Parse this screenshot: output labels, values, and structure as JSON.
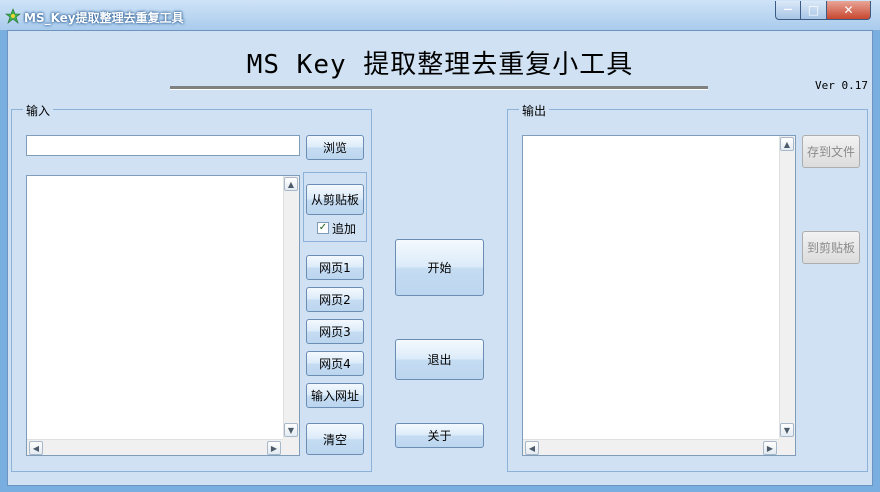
{
  "window": {
    "title": "MS_Key提取整理去重复工具",
    "controls": {
      "minimize": "—",
      "maximize": "□",
      "close": "✕"
    }
  },
  "header": {
    "title": "MS Key 提取整理去重复小工具",
    "version": "Ver 0.17"
  },
  "input_group": {
    "label": "输入",
    "path_value": "",
    "browse_label": "浏览",
    "text_value": "",
    "clipboard_label": "从剪贴板",
    "append_label": "追加",
    "append_checked": true,
    "web1_label": "网页1",
    "web2_label": "网页2",
    "web3_label": "网页3",
    "web4_label": "网页4",
    "enter_url_label": "输入网址",
    "clear_label": "清空"
  },
  "actions": {
    "start_label": "开始",
    "exit_label": "退出",
    "about_label": "关于"
  },
  "output_group": {
    "label": "输出",
    "text_value": "",
    "save_file_label": "存到文件",
    "to_clipboard_label": "到剪贴板"
  },
  "icons": {
    "app": "app-icon",
    "scroll_up": "▲",
    "scroll_down": "▼",
    "scroll_left": "◀",
    "scroll_right": "▶"
  },
  "colors": {
    "window_frame": "#78aee0",
    "client_bg": "#cfe1f3",
    "close_button": "#c7472f"
  }
}
